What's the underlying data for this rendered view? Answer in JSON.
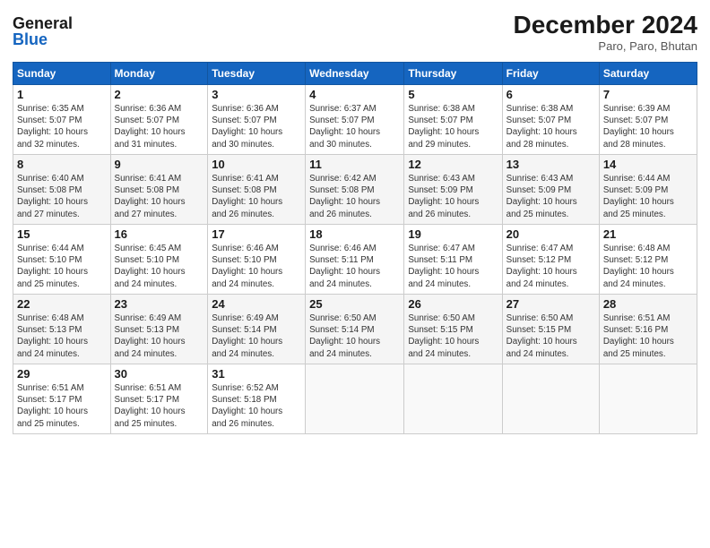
{
  "logo": {
    "line1": "General",
    "line2": "Blue"
  },
  "title": "December 2024",
  "location": "Paro, Paro, Bhutan",
  "days_of_week": [
    "Sunday",
    "Monday",
    "Tuesday",
    "Wednesday",
    "Thursday",
    "Friday",
    "Saturday"
  ],
  "weeks": [
    [
      {
        "day": "1",
        "info": "Sunrise: 6:35 AM\nSunset: 5:07 PM\nDaylight: 10 hours\nand 32 minutes."
      },
      {
        "day": "2",
        "info": "Sunrise: 6:36 AM\nSunset: 5:07 PM\nDaylight: 10 hours\nand 31 minutes."
      },
      {
        "day": "3",
        "info": "Sunrise: 6:36 AM\nSunset: 5:07 PM\nDaylight: 10 hours\nand 30 minutes."
      },
      {
        "day": "4",
        "info": "Sunrise: 6:37 AM\nSunset: 5:07 PM\nDaylight: 10 hours\nand 30 minutes."
      },
      {
        "day": "5",
        "info": "Sunrise: 6:38 AM\nSunset: 5:07 PM\nDaylight: 10 hours\nand 29 minutes."
      },
      {
        "day": "6",
        "info": "Sunrise: 6:38 AM\nSunset: 5:07 PM\nDaylight: 10 hours\nand 28 minutes."
      },
      {
        "day": "7",
        "info": "Sunrise: 6:39 AM\nSunset: 5:07 PM\nDaylight: 10 hours\nand 28 minutes."
      }
    ],
    [
      {
        "day": "8",
        "info": "Sunrise: 6:40 AM\nSunset: 5:08 PM\nDaylight: 10 hours\nand 27 minutes."
      },
      {
        "day": "9",
        "info": "Sunrise: 6:41 AM\nSunset: 5:08 PM\nDaylight: 10 hours\nand 27 minutes."
      },
      {
        "day": "10",
        "info": "Sunrise: 6:41 AM\nSunset: 5:08 PM\nDaylight: 10 hours\nand 26 minutes."
      },
      {
        "day": "11",
        "info": "Sunrise: 6:42 AM\nSunset: 5:08 PM\nDaylight: 10 hours\nand 26 minutes."
      },
      {
        "day": "12",
        "info": "Sunrise: 6:43 AM\nSunset: 5:09 PM\nDaylight: 10 hours\nand 26 minutes."
      },
      {
        "day": "13",
        "info": "Sunrise: 6:43 AM\nSunset: 5:09 PM\nDaylight: 10 hours\nand 25 minutes."
      },
      {
        "day": "14",
        "info": "Sunrise: 6:44 AM\nSunset: 5:09 PM\nDaylight: 10 hours\nand 25 minutes."
      }
    ],
    [
      {
        "day": "15",
        "info": "Sunrise: 6:44 AM\nSunset: 5:10 PM\nDaylight: 10 hours\nand 25 minutes."
      },
      {
        "day": "16",
        "info": "Sunrise: 6:45 AM\nSunset: 5:10 PM\nDaylight: 10 hours\nand 24 minutes."
      },
      {
        "day": "17",
        "info": "Sunrise: 6:46 AM\nSunset: 5:10 PM\nDaylight: 10 hours\nand 24 minutes."
      },
      {
        "day": "18",
        "info": "Sunrise: 6:46 AM\nSunset: 5:11 PM\nDaylight: 10 hours\nand 24 minutes."
      },
      {
        "day": "19",
        "info": "Sunrise: 6:47 AM\nSunset: 5:11 PM\nDaylight: 10 hours\nand 24 minutes."
      },
      {
        "day": "20",
        "info": "Sunrise: 6:47 AM\nSunset: 5:12 PM\nDaylight: 10 hours\nand 24 minutes."
      },
      {
        "day": "21",
        "info": "Sunrise: 6:48 AM\nSunset: 5:12 PM\nDaylight: 10 hours\nand 24 minutes."
      }
    ],
    [
      {
        "day": "22",
        "info": "Sunrise: 6:48 AM\nSunset: 5:13 PM\nDaylight: 10 hours\nand 24 minutes."
      },
      {
        "day": "23",
        "info": "Sunrise: 6:49 AM\nSunset: 5:13 PM\nDaylight: 10 hours\nand 24 minutes."
      },
      {
        "day": "24",
        "info": "Sunrise: 6:49 AM\nSunset: 5:14 PM\nDaylight: 10 hours\nand 24 minutes."
      },
      {
        "day": "25",
        "info": "Sunrise: 6:50 AM\nSunset: 5:14 PM\nDaylight: 10 hours\nand 24 minutes."
      },
      {
        "day": "26",
        "info": "Sunrise: 6:50 AM\nSunset: 5:15 PM\nDaylight: 10 hours\nand 24 minutes."
      },
      {
        "day": "27",
        "info": "Sunrise: 6:50 AM\nSunset: 5:15 PM\nDaylight: 10 hours\nand 24 minutes."
      },
      {
        "day": "28",
        "info": "Sunrise: 6:51 AM\nSunset: 5:16 PM\nDaylight: 10 hours\nand 25 minutes."
      }
    ],
    [
      {
        "day": "29",
        "info": "Sunrise: 6:51 AM\nSunset: 5:17 PM\nDaylight: 10 hours\nand 25 minutes."
      },
      {
        "day": "30",
        "info": "Sunrise: 6:51 AM\nSunset: 5:17 PM\nDaylight: 10 hours\nand 25 minutes."
      },
      {
        "day": "31",
        "info": "Sunrise: 6:52 AM\nSunset: 5:18 PM\nDaylight: 10 hours\nand 26 minutes."
      },
      {
        "day": "",
        "info": ""
      },
      {
        "day": "",
        "info": ""
      },
      {
        "day": "",
        "info": ""
      },
      {
        "day": "",
        "info": ""
      }
    ]
  ]
}
